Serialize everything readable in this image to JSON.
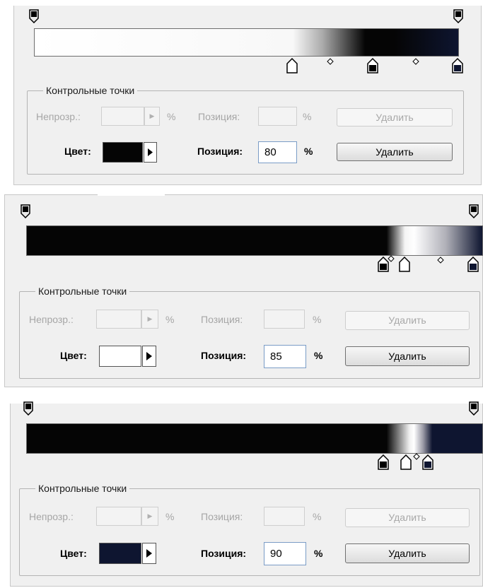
{
  "panels": [
    {
      "legend": "Контрольные точки",
      "opacity_label": "Непрозр.:",
      "opacity_value": "",
      "opacity_pct": "%",
      "opacity_position_label": "Позиция:",
      "opacity_position_value": "",
      "opacity_position_pct": "%",
      "opacity_delete_label": "Удалить",
      "color_label": "Цвет:",
      "color_position_label": "Позиция:",
      "color_position_value": "80",
      "color_position_pct": "%",
      "color_delete_label": "Удалить",
      "swatch_color": "#050505"
    },
    {
      "legend": "Контрольные точки",
      "opacity_label": "Непрозр.:",
      "opacity_value": "",
      "opacity_pct": "%",
      "opacity_position_label": "Позиция:",
      "opacity_position_value": "",
      "opacity_position_pct": "%",
      "opacity_delete_label": "Удалить",
      "color_label": "Цвет:",
      "color_position_label": "Позиция:",
      "color_position_value": "85",
      "color_position_pct": "%",
      "color_delete_label": "Удалить",
      "swatch_color": "#ffffff"
    },
    {
      "legend": "Контрольные точки",
      "opacity_label": "Непрозр.:",
      "opacity_value": "",
      "opacity_pct": "%",
      "opacity_position_label": "Позиция:",
      "opacity_position_value": "",
      "opacity_position_pct": "%",
      "opacity_delete_label": "Удалить",
      "color_label": "Цвет:",
      "color_position_label": "Позиция:",
      "color_position_value": "90",
      "color_position_pct": "%",
      "color_delete_label": "Удалить",
      "swatch_color": "#0e1530"
    }
  ],
  "colors": {
    "black": "#050505",
    "white": "#ffffff",
    "navy": "#0e1530",
    "panel_bg": "#f0f0f0"
  },
  "icons": {
    "opacity_stop": "opacity-stop-icon",
    "color_stop": "color-stop-icon",
    "midpoint": "midpoint-diamond-icon",
    "spinner": "spinner-arrow-icon",
    "flyout": "flyout-triangle-icon"
  }
}
